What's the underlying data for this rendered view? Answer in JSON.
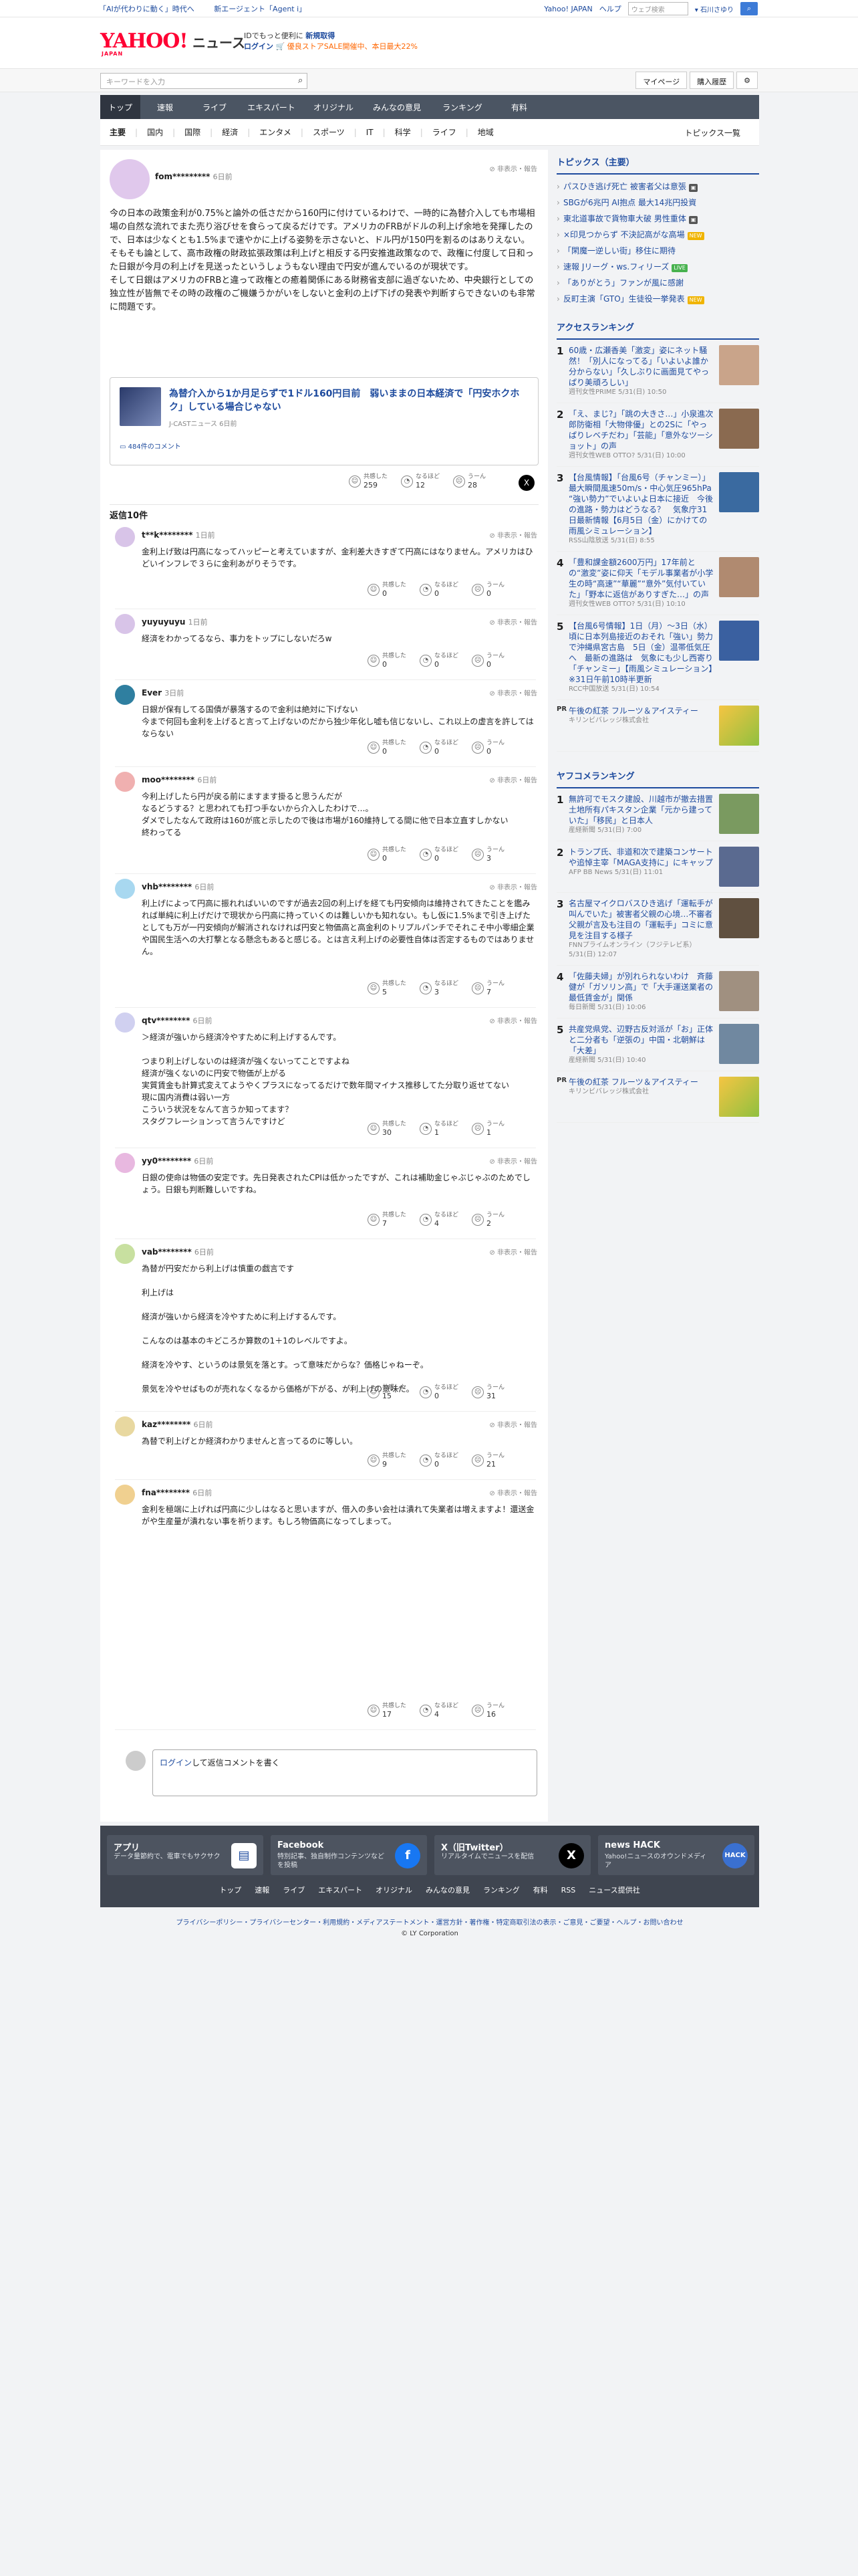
{
  "top_strip": {
    "links": [
      "「AIが代わりに動く」時代へ",
      "新エージェント「Agent i」"
    ],
    "right_links": [
      "Yahoo! JAPAN",
      "ヘルプ"
    ],
    "search_placeholder": "ウェブ検索",
    "region": "石川さゆり"
  },
  "header": {
    "logo": "YAHOO!",
    "logo_sub": "JAPAN",
    "service": "ニュース",
    "promo_line1_a": "IDでもっと便利に",
    "promo_line1_b": "新規取得",
    "promo_line2_a": "ログイン",
    "promo_line2_b": "🛒 ",
    "promo_line2_c": "優良ストアSALE開催中、本日最大22%"
  },
  "search": {
    "placeholder": "キーワードを入力",
    "mypage": "マイページ",
    "history": "購入履歴"
  },
  "nav1": [
    "トップ",
    "速報",
    "ライブ",
    "エキスパート",
    "オリジナル",
    "みんなの意見",
    "ランキング",
    "有料"
  ],
  "nav2": {
    "items": [
      "主要",
      "国内",
      "国際",
      "経済",
      "エンタメ",
      "スポーツ",
      "IT",
      "科学",
      "ライフ",
      "地域"
    ],
    "right": "トピックス一覧"
  },
  "main_comment": {
    "user": "fom*********",
    "time": "6日前",
    "report": "非表示・報告",
    "text": "今の日本の政策金利が0.75%と論外の低さだから160円に付けているわけで、一時的に為替介入しても市場相場の自然な流れでまた売り浴びせを食らって戻るだけです。アメリカのFRBがドルの利上げ余地を発揮したので、日本は少なくとも1.5%まで速やかに上げる姿勢を示さないと、ドル円が150円を割るのはありえない。\nそもそも論として、高市政権の財政拡張政策は利上げと相反する円安推進政策なので、政権に付度して日和った日銀が今月の利上げを見送ったというしょうもない理由で円安が進んでいるのが現状です。\nそして日銀はアメリカのFRBと違って政権との癒着関係にある財務省支部に過ぎないため、中央銀行としての独立性が皆無でその時の政権のご機嫌うかがいをしないと金利の上げ下げの発表や判断すらできないのも非常に問題です。",
    "embed": {
      "title": "為替介入から1か月足らずで1ドル160円目前　弱いままの日本経済で「円安ホクホク」している場合じゃない",
      "source": "J-CASTニュース 6日前",
      "comments": "484件のコメント"
    },
    "reactions": {
      "agree_label": "共感した",
      "agree": "259",
      "insight_label": "なるほど",
      "insight": "12",
      "hmm_label": "うーん",
      "hmm": "28"
    }
  },
  "replies_title": "返信10件",
  "replies": [
    {
      "user": "t**k********",
      "time": "1日前",
      "text": "金利上げ致は円高になってハッピーと考えていますが、金利差大きすぎて円高にはなりません。アメリカはひどいインフレで３らに金利あがりそうです。",
      "a": "0",
      "i": "0",
      "h": "0",
      "color": "#d8c4e8"
    },
    {
      "user": "yuyuyuyu",
      "time": "1日前",
      "text": "経済をわかってるなら、事力をトップにしないだろw",
      "a": "0",
      "i": "0",
      "h": "0",
      "color": "#d8c4e8"
    },
    {
      "user": "Ever",
      "time": "3日前",
      "text": "日銀が保有してる国債が暴落するので金利は絶対に下げない\n今まで何回も金利を上げると言って上げないのだから独少年化し嘘も信じないし、これ以上の虚言を許してはならない",
      "a": "0",
      "i": "0",
      "h": "0",
      "color": "#2f7fa0"
    },
    {
      "user": "moo********",
      "time": "6日前",
      "text": "今利上げしたら円が戻る前にますます掛ると思うんだが\nなるどうする？と思われても打つ手ないから介入したわけで…。\nダメでしたなんて政府は160が底と示したので後は市場が160維持してる間に他で日本立直すしかない\n終わってる",
      "a": "0",
      "i": "0",
      "h": "3",
      "color": "#f0b0b0"
    },
    {
      "user": "vhb********",
      "time": "6日前",
      "text": "利上げによって円高に振れればいいのですが過去2回の利上げを経ても円安傾向は維持されてきたことを鑑みれば単純に利上げだけで現状から円高に持っていくのは難しいかも知れない。もし仮に1.5%まで引き上げたとしても万が一円安傾向が解消されなければ円安と物価高と高金利のトリプルパンチでそれこそ中小零細企業や国民生活への大打撃となる懸念もあると感じる。とは言え利上げの必要性自体は否定するものではありません。",
      "a": "5",
      "i": "3",
      "h": "7",
      "color": "#a8d8f0"
    },
    {
      "user": "qtv********",
      "time": "6日前",
      "text": "＞経済が強いから経済冷やすために利上げするんです。\n\nつまり利上げしないのは経済が強くないってことですよね\n経済が強くないのに円安で物価が上がる\n実質賃金も計算式変えてようやくプラスになってるだけで数年間マイナス推移してた分取り返せてない\n現に国内消費は弱い一方\nこういう状況をなんて言うか知ってます？\nスタグフレーションって言うんですけど",
      "a": "30",
      "i": "1",
      "h": "1",
      "color": "#d0d0f0"
    },
    {
      "user": "yy0********",
      "time": "6日前",
      "text": "日銀の使命は物価の安定です。先日発表されたCPIは低かったですが、これは補助金じゃぶじゃぶのためでしょう。日銀も判断難しいですね。",
      "a": "7",
      "i": "4",
      "h": "2",
      "color": "#e8b8e0"
    },
    {
      "user": "vab********",
      "time": "6日前",
      "text": "為替が円安だから利上げは慎重の戯言です\n\n利上げは\n\n経済が強いから経済を冷やすために利上げするんです。\n\nこんなのは基本のキどころか算数の1＋1のレベルですよ。\n\n経済を冷やす、というのは景気を落とす。って意味だからな？価格じゃねーぞ。\n\n景気を冷やせばものが売れなくなるから価格が下がる、が利上げの意味だ。",
      "a": "15",
      "i": "0",
      "h": "31",
      "color": "#c8e0a0"
    },
    {
      "user": "kaz********",
      "time": "6日前",
      "text": "為替で利上げとか経済わかりませんと言ってるのに等しい。",
      "a": "9",
      "i": "0",
      "h": "21",
      "color": "#e8d8a0"
    },
    {
      "user": "fna********",
      "time": "6日前",
      "text": "金利を極端に上げれば円高に少しはなると思いますが、借入の多い会社は潰れて失業者は増えますよ！還送金がや生産量が潰れない事を祈ります。もしろ物価高になってしまって。",
      "a": "17",
      "i": "4",
      "h": "16",
      "color": "#f0d090"
    }
  ],
  "reply_box": {
    "login": "ログイン",
    "placeholder": "して返信コメントを書く"
  },
  "topics": {
    "title": "トピックス（主要）",
    "items": [
      {
        "t": "パスひき逃げ死亡 被害者父は意張",
        "b": "img"
      },
      {
        "t": "SBGが6兆円 AI抱点 最大14兆円投資",
        "b": ""
      },
      {
        "t": "東北道事故で貨物車大破 男性重体",
        "b": "img"
      },
      {
        "t": "×印見つからず 不決記高がな高場",
        "b": "new"
      },
      {
        "t": "「閑魔一逆しい街」移住に期待",
        "b": ""
      },
      {
        "t": "速報 Jリーグ・ws.フィリーズ",
        "b": "live"
      },
      {
        "t": "「ありがとう」ファンが風に感謝",
        "b": ""
      },
      {
        "t": "反町主演「GTO」生徒役一挙発表",
        "b": "new"
      }
    ]
  },
  "access_ranking": {
    "title": "アクセスランキング",
    "items": [
      {
        "n": "1",
        "t": "60歳・広瀬香美「激変」姿にネット騒然！「別人になってる」「いよいよ誰か分からない」「久しぶりに画面見てやっぱり美頑ろしい」",
        "s": "週刊女性PRIME 5/31(日) 10:50",
        "c": "#c9a48a"
      },
      {
        "n": "2",
        "t": "「え、まじ?」「跳の大きさ…」小泉進次郎防衛相「大物俳優」との2Sに「やっぱりレベチだわ」「芸能」「意外なツーショット」の声",
        "s": "週刊女性WEB OTTO? 5/31(日) 10:00",
        "c": "#8a6a50"
      },
      {
        "n": "3",
        "t": "【台風情報】「台風6号（チャンミー）」最大瞬間風速50m/s・中心気圧965hPa “強い勢力”でいよいよ日本に接近　今後の進路・勢力はどうなる？　気象庁31日最新情報【6月5日（金）にかけての雨風シミュレーション】",
        "s": "RSS山陰放送 5/31(日) 8:55",
        "c": "#3a6aa0"
      },
      {
        "n": "4",
        "t": "「豊和課金額2600万円」17年前との“激変”姿に仰天「モデル事業者が小学生の時“高速”“華麗”“意外”気付いていた」「野本に返信がありすぎた…」の声",
        "s": "週刊女性WEB OTTO? 5/31(日) 10:10",
        "c": "#b08a70"
      },
      {
        "n": "5",
        "t": "【台風6号情報】1日（月）～3日（水）頃に日本列島接近のおそれ「強い」勢力で沖縄県宮古島　5日（金）温帯低気圧へ　最新の進路は　気象にも少し西寄り「チャンミー」【雨風シミュレーション】※31日午前10時半更新",
        "s": "RCC中国放送 5/31(日) 10:54",
        "c": "#3a60a0"
      }
    ]
  },
  "pr1": {
    "tag": "PR",
    "t": "午後の紅茶 フルーツ＆アイスティー",
    "s": "キリンビバレッジ株式会社"
  },
  "yafoo_ranking": {
    "title": "ヤフコメランキング",
    "items": [
      {
        "n": "1",
        "t": "無許可でモスク建設、川越市が撤去措置　土地所有パキスタン企業「元から建っていた」「移民」と日本人",
        "s": "産経新聞 5/31(日) 7:00",
        "c": "#7a9a60"
      },
      {
        "n": "2",
        "t": "トランプ氏、非道和次で建築コンサートや追悼主宰「MAGA支持に」にキャップ",
        "s": "AFP BB News 5/31(日) 11:01",
        "c": "#5a6a90"
      },
      {
        "n": "3",
        "t": "名古屋マイクロバスひき逃げ「運転手が叫んでいた」被害者父親の心境…不審者父親が言及も注目の「運転手」コミに意見を注目する様子",
        "s": "FNNプライムオンライン（フジテレビ系）5/31(日) 12:07",
        "c": "#605040"
      },
      {
        "n": "4",
        "t": "「佐藤夫婦」が別れられないわけ　斉藤健が「ガソリン高」で「大手運送業者の最低賃金が」関係",
        "s": "毎日新聞 5/31(日) 10:06",
        "c": "#a09080"
      },
      {
        "n": "5",
        "t": "共産党県党、辺野古反対派が「お」正体と二分者も「逆張の」中国・北朝鮮は「大差」",
        "s": "産経新聞 5/31(日) 10:40",
        "c": "#7088a0"
      }
    ]
  },
  "pr2": {
    "tag": "PR",
    "t": "午後の紅茶 フルーツ＆アイスティー",
    "s": "キリンビバレッジ株式会社"
  },
  "footer": {
    "boxes": [
      {
        "t": "アプリ",
        "d": "データ量節約で、電車でもサクサク"
      },
      {
        "t": "Facebook",
        "d": "特別記事、独自制作コンテンツなどを投稿"
      },
      {
        "t": "X（旧Twitter）",
        "d": "リアルタイムでニュースを配信"
      },
      {
        "t": "news HACK",
        "d": "Yahoo!ニュースのオウンドメディア"
      }
    ],
    "links": [
      "トップ",
      "速報",
      "ライブ",
      "エキスパート",
      "オリジナル",
      "みんなの意見",
      "ランキング",
      "有料",
      "RSS",
      "ニュース提供社"
    ],
    "legal": "プライバシーポリシー・プライバシーセンター・利用規約・メディアステートメント・運営方針・著作権・特定商取引法の表示・ご意見・ご要望・ヘルプ・お問い合わせ",
    "copyright": "© LY Corporation"
  },
  "colors": {
    "brand_red": "#ff0033",
    "nav": "#4b5563",
    "link": "#1e4b9e"
  }
}
